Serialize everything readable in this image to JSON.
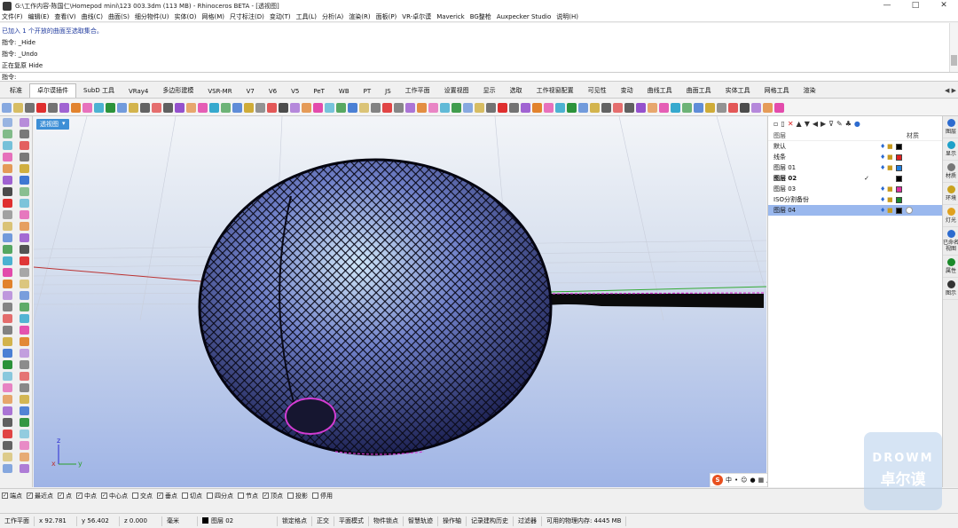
{
  "window": {
    "title": "G:\\工作内容-陈国仁\\Homepod mini\\123 003.3dm (113 MB) - Rhinoceros BETA - [透视图]",
    "controls": [
      "—",
      "□",
      "✕"
    ]
  },
  "menu": [
    "文件(F)",
    "编辑(E)",
    "查看(V)",
    "曲线(C)",
    "曲面(S)",
    "细分物件(U)",
    "实体(O)",
    "网格(M)",
    "尺寸标注(D)",
    "变动(T)",
    "工具(L)",
    "分析(A)",
    "渲染(R)",
    "面板(P)",
    "VR-卓尔谟",
    "Maverick",
    "BG整枪",
    "Auxpecker Studio",
    "说明(H)"
  ],
  "command_history": [
    "已加入 1 个开放的曲面至选取集合。",
    "指令: _Hide",
    "指令: _Undo",
    "正在复原 Hide"
  ],
  "command_prompt": "指令:",
  "toolbar_tabs": [
    "标准",
    "卓尔谟插件",
    "SubD 工具",
    "VRay4",
    "多边形建模",
    "VSR-MR",
    "V7",
    "V6",
    "V5",
    "PeT",
    "WB",
    "PT",
    "JS",
    "工作平面",
    "设置视图",
    "显示",
    "选取",
    "工作视窗配置",
    "可见性",
    "变动",
    "曲线工具",
    "曲面工具",
    "实体工具",
    "网格工具",
    "渲染"
  ],
  "active_tab_index": 1,
  "viewport": {
    "label": "透视图",
    "axes": {
      "x": "x",
      "y": "y",
      "z": "z"
    }
  },
  "layers_panel": {
    "col_name": "图层",
    "col_material": "材质",
    "layers": [
      {
        "name": "默认",
        "color": "#000000",
        "current": false,
        "selected": false,
        "bold": false
      },
      {
        "name": "线条",
        "color": "#e02020",
        "current": false,
        "selected": false,
        "bold": false
      },
      {
        "name": "图层 01",
        "color": "#1e7fe0",
        "current": false,
        "selected": false,
        "bold": false
      },
      {
        "name": "图层 02",
        "color": "#000000",
        "current": true,
        "selected": false,
        "bold": true
      },
      {
        "name": "图层 03",
        "color": "#e02ea0",
        "current": false,
        "selected": false,
        "bold": false
      },
      {
        "name": "ISO分割备份",
        "color": "#1a8a2a",
        "current": false,
        "selected": false,
        "bold": false
      },
      {
        "name": "图层 04",
        "color": "#000000",
        "current": false,
        "selected": true,
        "bold": false
      }
    ],
    "current_mark": "✓"
  },
  "right_tabs": [
    "图层",
    "显示",
    "材质",
    "环境",
    "灯光",
    "已命名视图",
    "属性",
    "图示"
  ],
  "osnaps": [
    {
      "label": "端点",
      "on": true
    },
    {
      "label": "最近点",
      "on": true
    },
    {
      "label": "点",
      "on": true
    },
    {
      "label": "中点",
      "on": true
    },
    {
      "label": "中心点",
      "on": true
    },
    {
      "label": "交点",
      "on": false
    },
    {
      "label": "垂点",
      "on": true
    },
    {
      "label": "切点",
      "on": false
    },
    {
      "label": "四分点",
      "on": false
    },
    {
      "label": "节点",
      "on": false
    },
    {
      "label": "顶点",
      "on": true
    },
    {
      "label": "投影",
      "on": false
    },
    {
      "label": "停用",
      "on": false
    }
  ],
  "ime_bar": {
    "logo": "S",
    "lang": "中"
  },
  "status": {
    "plane": "工作平面",
    "x": "x 92.781",
    "y": "y 56.402",
    "z": "z 0.000",
    "unit": "毫米",
    "layer": "图层 02",
    "items": [
      "锁定格点",
      "正交",
      "平面模式",
      "物件锁点",
      "智慧轨迹",
      "操作轴",
      "记录建构历史",
      "过滤器",
      "可用的物理内存: 4445 MB"
    ]
  },
  "watermark": {
    "line1": "DROWM",
    "line2": "卓尔谟"
  }
}
